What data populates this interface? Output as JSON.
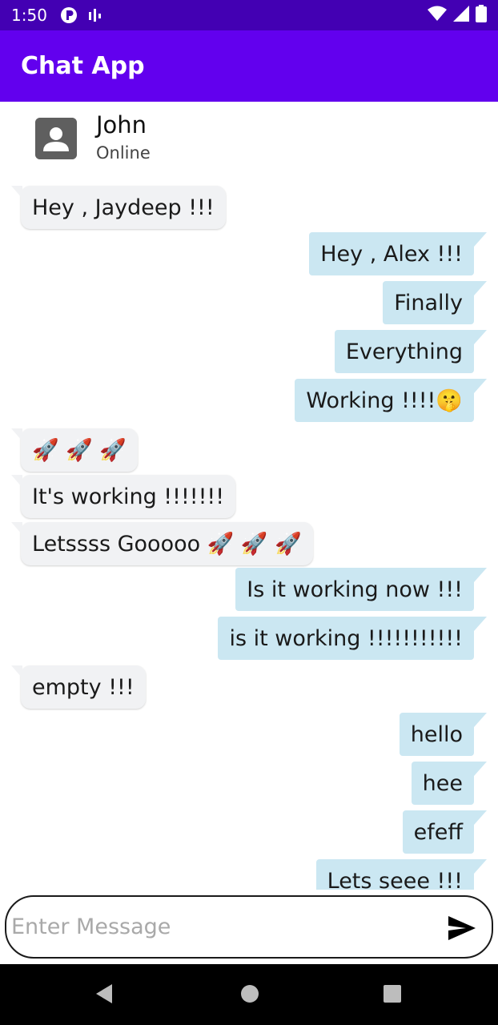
{
  "status_bar": {
    "time": "1:50",
    "icons": [
      "p-circle-icon",
      "signal-bars-icon",
      "wifi-icon",
      "cell-signal-icon",
      "battery-icon"
    ]
  },
  "app_bar": {
    "title": "Chat App",
    "color": "#6200ee"
  },
  "contact": {
    "name": "John",
    "status": "Online",
    "avatar_icon": "person-icon"
  },
  "messages": [
    {
      "side": "received",
      "text": "Hey , Jaydeep !!!"
    },
    {
      "side": "sent",
      "text": "Hey , Alex !!!"
    },
    {
      "side": "sent",
      "text": "Finally"
    },
    {
      "side": "sent",
      "text": "Everything"
    },
    {
      "side": "sent",
      "text": "Working !!!!🤫"
    },
    {
      "side": "received",
      "text": "🚀 🚀 🚀"
    },
    {
      "side": "received",
      "text": "It's working !!!!!!!"
    },
    {
      "side": "received",
      "text": "Letssss Gooooo 🚀 🚀 🚀"
    },
    {
      "side": "sent",
      "text": "Is it working now !!!"
    },
    {
      "side": "sent",
      "text": "is it working !!!!!!!!!!!"
    },
    {
      "side": "received",
      "text": "empty !!!"
    },
    {
      "side": "sent",
      "text": "hello"
    },
    {
      "side": "sent",
      "text": "hee"
    },
    {
      "side": "sent",
      "text": "efeff"
    },
    {
      "side": "sent",
      "text": "Lets seee !!!"
    }
  ],
  "composer": {
    "placeholder": "Enter Message",
    "value": "",
    "send_icon": "send-icon"
  },
  "nav_bar": {
    "icons": [
      "back-icon",
      "home-icon",
      "recents-icon"
    ]
  },
  "colors": {
    "sent_bubble": "#cbe7f2",
    "received_bubble": "#f1f2f4",
    "status_bar": "#4300b3"
  }
}
